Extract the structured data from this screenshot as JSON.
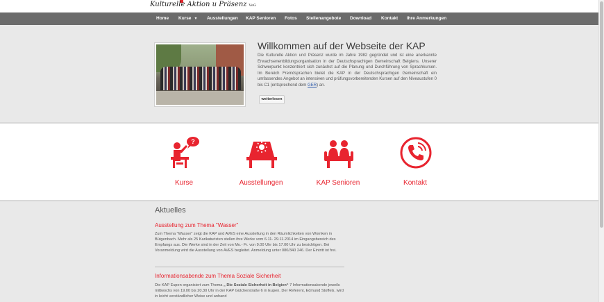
{
  "header": {
    "logo_text": "Kulturelle Aktion u Präsenz",
    "logo_suffix": "VoG"
  },
  "nav": {
    "items": [
      {
        "label": "Home"
      },
      {
        "label": "Kurse",
        "has_dropdown": true
      },
      {
        "label": "Ausstellungen"
      },
      {
        "label": "KAP Senioren"
      },
      {
        "label": "Fotos"
      },
      {
        "label": "Stellenangebote"
      },
      {
        "label": "Download"
      },
      {
        "label": "Kontakt"
      },
      {
        "label": "Ihre Anmerkungen"
      }
    ]
  },
  "hero": {
    "title": "Willkommen auf der Webseite der KAP",
    "paragraph_before_link": "Die Kulturelle Aktion und Präsenz wurde im Jahre 1982 gegründet und ist eine anerkannte Erwachsenenbildungsorganisation in der Deutschsprachigen Gemeinschaft Belgiens. Unserer Schwerpunkt konzentriert sich zunächst auf die Planung und Durchführung von Sprachkursen. Im Bereich Fremdsprachen bietet die KAP in der Deutschsprachigen Gemeinschaft ein umfassendes Angebot an intensiven und prüfungsvorbereitenden Kursen auf den Niveaustufen 0 bis C1 (entsprechend dem ",
    "link_text": "GER",
    "paragraph_after_link": ") an.",
    "button_label": "weiterlesen"
  },
  "services": [
    {
      "label": "Kurse",
      "icon": "teacher-icon"
    },
    {
      "label": "Ausstellungen",
      "icon": "exhibition-icon"
    },
    {
      "label": "KAP Senioren",
      "icon": "seniors-icon"
    },
    {
      "label": "Kontakt",
      "icon": "phone-icon"
    }
  ],
  "news": {
    "heading": "Aktuelles",
    "items": [
      {
        "title": "Ausstellung zum Thema \"Wasser\"",
        "text": "Zum Thema \"Wasser\" zeigt die KAP und AVES eine Ausstellung in den Räumlichkeiten von Wornken in Bütgenbach. Mehr als 25 Karikaturisten stellen ihre Werke vom 6.11- 29.11.2014 im Eingangsbereich des Empfangs aus. Die Werke sind in der Zeit von Mo.- Fr. von 9.00 Uhr bis 17.00 Uhr zu besichtigen. Bei Voranmeldung wird die Ausstellung von AVES begleitet. Anmeldung unter 080/340 246. Der Eintritt ist frei."
      },
      {
        "title": "Informationsabende zum Thema Soziale Sicherheit",
        "text_before_bold": "Die KAP Eupen organisiert zum Thema ",
        "text_bold": "„ Die Soziale Sicherheit in Belgien“",
        "text_after_bold": "  7 Informationsabende jeweils mittwochs von 19.00 bis 20.30 Uhr in der KAP Gülcherstraße 6 in Eupen. Der Referent, Edmund Stoffels, wird in leicht verständlicher Weise und anhand"
      }
    ]
  },
  "colors": {
    "accent": "#e8242f",
    "nav_bg": "#6b6b6b",
    "page_bg": "#e9e9e9"
  }
}
